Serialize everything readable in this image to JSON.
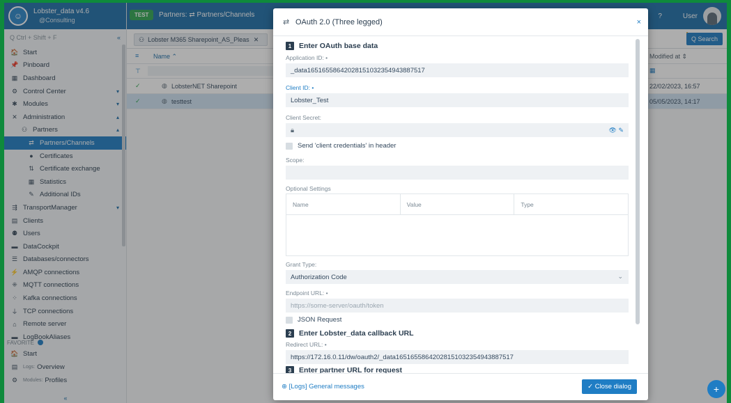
{
  "app": {
    "name": "Lobster_data v4.6",
    "org": "@Consulting",
    "search_placeholder": "Q Ctrl + Shift + F",
    "collapse_glyph": "«"
  },
  "topbar": {
    "badge": "TEST",
    "breadcrumb_a": "Partners:",
    "breadcrumb_b": "Partners/Channels",
    "help_glyph": "?",
    "user": "User"
  },
  "sidebar": {
    "items": [
      {
        "label": "Start",
        "icon": "home-icon",
        "glyph": "🏠",
        "level": 0
      },
      {
        "label": "Pinboard",
        "icon": "pin-icon",
        "glyph": "📌",
        "level": 0
      },
      {
        "label": "Dashboard",
        "icon": "dashboard-icon",
        "glyph": "▦",
        "level": 0
      },
      {
        "label": "Control Center",
        "icon": "control-icon",
        "glyph": "⚙",
        "level": 0,
        "caret": "▾"
      },
      {
        "label": "Modules",
        "icon": "modules-icon",
        "glyph": "✱",
        "level": 0,
        "caret": "▾"
      },
      {
        "label": "Administration",
        "icon": "admin-icon",
        "glyph": "✕",
        "level": 0,
        "caret": "▴"
      },
      {
        "label": "Partners",
        "icon": "partners-icon",
        "glyph": "⚇",
        "level": 1,
        "caret": "▴"
      },
      {
        "label": "Partners/Channels",
        "icon": "channels-icon",
        "glyph": "⇄",
        "level": 2,
        "active": true
      },
      {
        "label": "Certificates",
        "icon": "certificate-icon",
        "glyph": "●",
        "level": 2
      },
      {
        "label": "Certificate exchange",
        "icon": "exchange-icon",
        "glyph": "⇅",
        "level": 2
      },
      {
        "label": "Statistics",
        "icon": "statistics-icon",
        "glyph": "▦",
        "level": 2
      },
      {
        "label": "Additional IDs",
        "icon": "ids-icon",
        "glyph": "✎",
        "level": 2
      },
      {
        "label": "TransportManager",
        "icon": "transport-icon",
        "glyph": "⇶",
        "level": 0,
        "caret": "▾"
      },
      {
        "label": "Clients",
        "icon": "clients-icon",
        "glyph": "▤",
        "level": 0
      },
      {
        "label": "Users",
        "icon": "users-icon",
        "glyph": "⚉",
        "level": 0
      },
      {
        "label": "DataCockpit",
        "icon": "cockpit-icon",
        "glyph": "▬",
        "level": 0
      },
      {
        "label": "Databases/connectors",
        "icon": "database-icon",
        "glyph": "☰",
        "level": 0
      },
      {
        "label": "AMQP connections",
        "icon": "amqp-icon",
        "glyph": "⚡",
        "level": 0
      },
      {
        "label": "MQTT connections",
        "icon": "mqtt-icon",
        "glyph": "⁜",
        "level": 0
      },
      {
        "label": "Kafka connections",
        "icon": "kafka-icon",
        "glyph": "⁘",
        "level": 0
      },
      {
        "label": "TCP connections",
        "icon": "tcp-icon",
        "glyph": "⏚",
        "level": 0
      },
      {
        "label": "Remote server",
        "icon": "remote-icon",
        "glyph": "⌂",
        "level": 0
      },
      {
        "label": "LogBookAliases",
        "icon": "logbook-icon",
        "glyph": "▬",
        "level": 0
      }
    ],
    "favorites_label": "FAVORITE",
    "favorites": [
      {
        "label": "Start",
        "prefix": "",
        "icon": "home-icon",
        "glyph": "🏠"
      },
      {
        "label": "Overview",
        "prefix": "Logs:",
        "icon": "logs-icon",
        "glyph": "▤"
      },
      {
        "label": "Profiles",
        "prefix": "Modules:",
        "icon": "profiles-icon",
        "glyph": "⚙"
      }
    ]
  },
  "main": {
    "tab_label": "Lobster M365 Sharepoint_AS_Pleas",
    "tab_close": "✕",
    "search_button": "Q Search",
    "columns": {
      "name": "Name ⌃",
      "modified": "Modified at ⇕"
    },
    "rows": [
      {
        "name": "LobsterNET Sharepoint",
        "modified": "22/02/2023, 16:57",
        "selected": false
      },
      {
        "name": "testtest",
        "modified": "05/05/2023, 14:17",
        "selected": true
      }
    ]
  },
  "dialog": {
    "title": "OAuth 2.0 (Three legged)",
    "close": "×",
    "section1": {
      "num": "1",
      "title": "Enter OAuth base data"
    },
    "application_id": {
      "label": "Application ID: •",
      "value": "_data16516558642028151032354943887517"
    },
    "client_id": {
      "label": "Client ID: •",
      "value": "Lobster_Test"
    },
    "client_secret": {
      "label": "Client Secret:",
      "value": ""
    },
    "send_creds_label": "Send 'client credentials' in header",
    "scope": {
      "label": "Scope:",
      "value": ""
    },
    "optional_settings": {
      "label": "Optional Settings",
      "columns": [
        "Name",
        "Value",
        "Type"
      ]
    },
    "grant_type": {
      "label": "Grant Type:",
      "value": "Authorization Code"
    },
    "endpoint_url": {
      "label": "Endpoint URL: •",
      "placeholder": "https://some-server/oauth/token"
    },
    "json_request_label": "JSON Request",
    "section2": {
      "num": "2",
      "title": "Enter Lobster_data callback URL"
    },
    "redirect_url": {
      "label": "Redirect URL: •",
      "value": "https://172.16.0.11/dw/oauth2/_data16516558642028151032354943887517"
    },
    "section3": {
      "num": "3",
      "title": "Enter partner URL for request"
    },
    "footer_link": "[Logs] General messages",
    "close_button": "✓ Close dialog"
  },
  "colors": {
    "accent": "#1f7dc4",
    "header": "#1e6ea8",
    "test_badge": "#2fa552",
    "frame": "#0f8a3c"
  }
}
